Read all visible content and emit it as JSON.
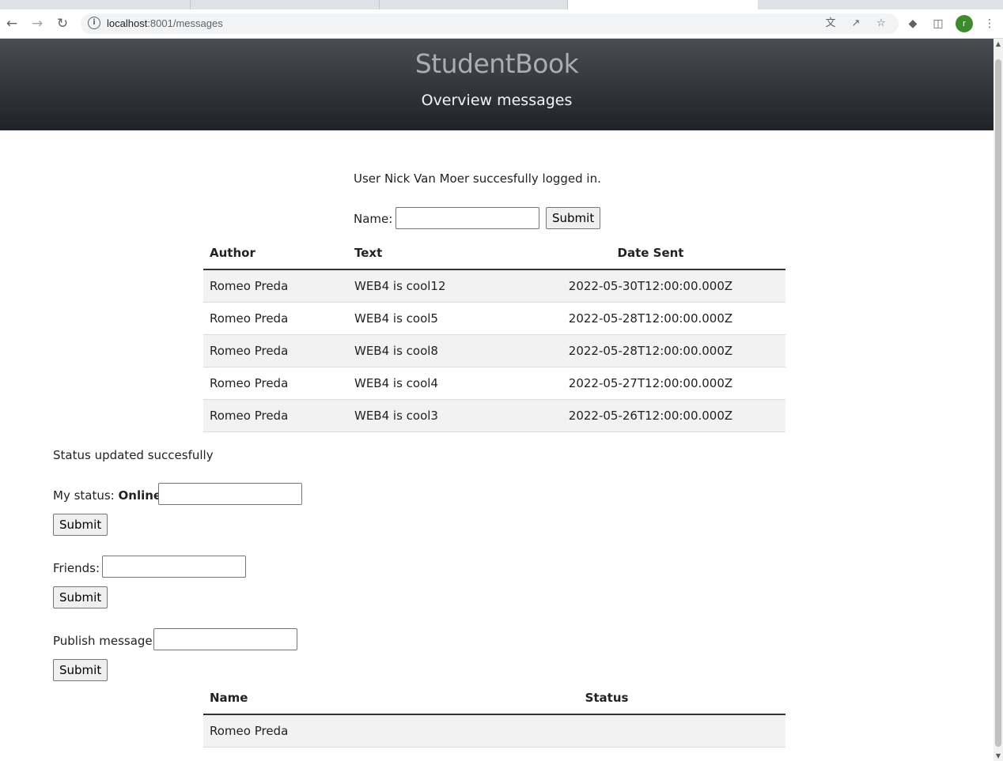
{
  "browser": {
    "url_host": "localhost",
    "url_rest": ":8001/messages",
    "profile_initial": "r"
  },
  "header": {
    "site_title": "StudentBook",
    "subtitle": "Overview messages"
  },
  "login_message": "User Nick Van Moer succesfully logged in.",
  "name_form": {
    "label": "Name:",
    "value": "",
    "submit": "Submit"
  },
  "messages_table": {
    "columns": [
      "Author",
      "Text",
      "Date Sent"
    ],
    "rows": [
      [
        "Romeo Preda",
        "WEB4 is cool12",
        "2022-05-30T12:00:00.000Z"
      ],
      [
        "Romeo Preda",
        "WEB4 is cool5",
        "2022-05-28T12:00:00.000Z"
      ],
      [
        "Romeo Preda",
        "WEB4 is cool8",
        "2022-05-28T12:00:00.000Z"
      ],
      [
        "Romeo Preda",
        "WEB4 is cool4",
        "2022-05-27T12:00:00.000Z"
      ],
      [
        "Romeo Preda",
        "WEB4 is cool3",
        "2022-05-26T12:00:00.000Z"
      ]
    ]
  },
  "status_message": "Status updated succesfully",
  "status_form": {
    "label": "My status:",
    "current": "Online",
    "value": "",
    "submit": "Submit"
  },
  "friends_form": {
    "label": "Friends:",
    "value": "",
    "submit": "Submit"
  },
  "publish_form": {
    "label": "Publish message:",
    "value": "",
    "submit": "Submit"
  },
  "friends_table": {
    "columns": [
      "Name",
      "Status"
    ],
    "rows": [
      [
        "Romeo Preda",
        ""
      ]
    ]
  },
  "icons": [
    "back-arrow-icon",
    "forward-arrow-icon",
    "reload-icon",
    "info-icon",
    "translate-icon",
    "share-icon",
    "star-icon",
    "extensions-icon",
    "side-panel-icon",
    "menu-icon"
  ]
}
